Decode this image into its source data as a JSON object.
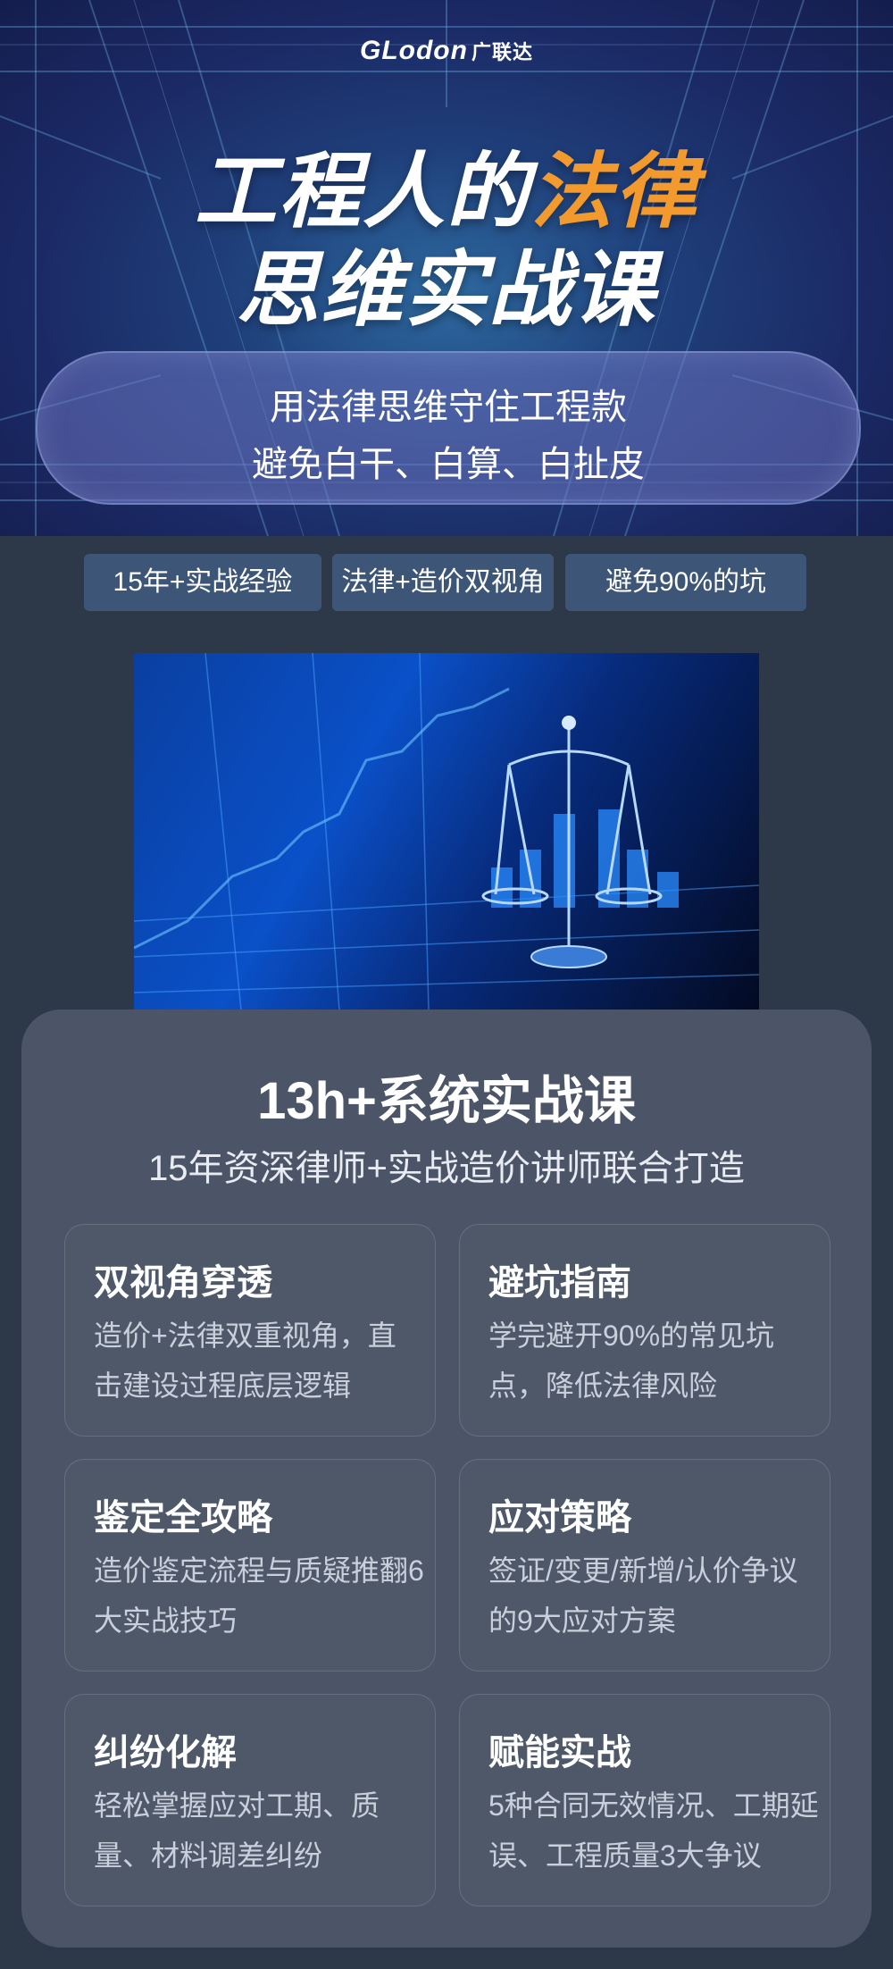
{
  "brand": {
    "logo_latin": "GLodon",
    "logo_cn": "广联达"
  },
  "hero": {
    "title_line1_prefix": "工程人的",
    "title_line1_accent": "法律",
    "title_line2": "思维实战课",
    "slogan_line1": "用法律思维守住工程款",
    "slogan_line2": "避免白干、白算、白扯皮",
    "accent_color": "#f29a2e"
  },
  "tags": [
    "15年+实战经验",
    "法律+造价双视角",
    "避免90%的坑"
  ],
  "illustration": {
    "icon": "scales-of-justice-icon"
  },
  "course": {
    "title": "13h+系统实战课",
    "subtitle": "15年资深律师+实战造价讲师联合打造",
    "features": [
      {
        "title": "双视角穿透",
        "desc": "造价+法律双重视角，直击建设过程底层逻辑"
      },
      {
        "title": "避坑指南",
        "desc": "学完避开90%的常见坑点，降低法律风险"
      },
      {
        "title": "鉴定全攻略",
        "desc": "造价鉴定流程与质疑推翻6大实战技巧"
      },
      {
        "title": "应对策略",
        "desc": "签证/变更/新增/认价争议的9大应对方案"
      },
      {
        "title": "纠纷化解",
        "desc": "轻松掌握应对工期、质量、材料调差纠纷"
      },
      {
        "title": "赋能实战",
        "desc": "5种合同无效情况、工期延误、工程质量3大争议"
      }
    ]
  }
}
